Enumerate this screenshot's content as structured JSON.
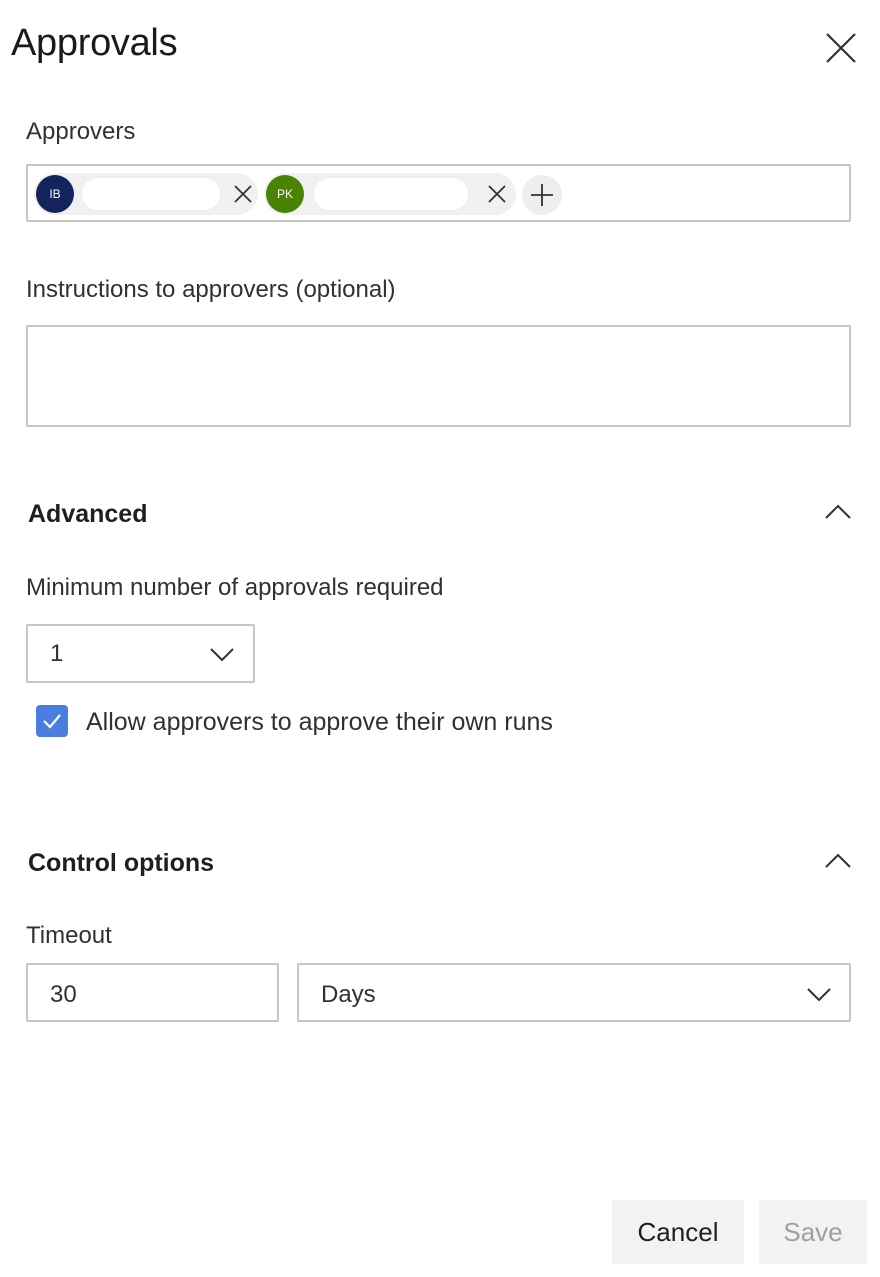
{
  "panel": {
    "title": "Approvals"
  },
  "approvers": {
    "label": "Approvers",
    "chips": [
      {
        "initials": "IB",
        "avatar_color": "#13235b"
      },
      {
        "initials": "PK",
        "avatar_color": "#498205"
      }
    ]
  },
  "instructions": {
    "label": "Instructions to approvers (optional)",
    "value": ""
  },
  "advanced": {
    "header": "Advanced",
    "min_approvals_label": "Minimum number of approvals required",
    "min_approvals_value": "1",
    "allow_self_approve_label": "Allow approvers to approve their own runs",
    "allow_self_approve_checked": true
  },
  "control_options": {
    "header": "Control options",
    "timeout_label": "Timeout",
    "timeout_value": "30",
    "timeout_unit": "Days"
  },
  "footer": {
    "cancel_label": "Cancel",
    "save_label": "Save"
  },
  "colors": {
    "checkbox_accent": "#4a7de0",
    "button_bg": "#f3f2f1",
    "disabled_text": "#a19f9d"
  }
}
